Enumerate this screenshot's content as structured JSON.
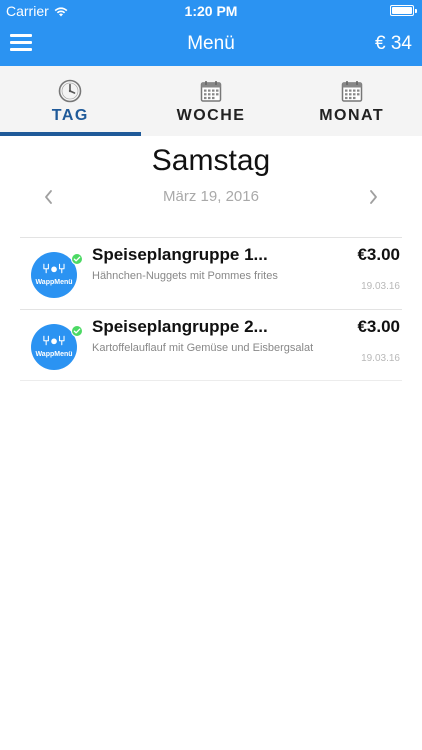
{
  "status_bar": {
    "carrier": "Carrier",
    "time": "1:20 PM",
    "wifi_icon": "wifi-icon",
    "battery_icon": "battery-icon"
  },
  "nav": {
    "title": "Menü",
    "balance": "€ 34",
    "menu_icon": "hamburger-menu-icon"
  },
  "tabs": [
    {
      "label": "TAG",
      "icon": "clock-icon",
      "active": true
    },
    {
      "label": "WOCHE",
      "icon": "calendar-icon",
      "active": false
    },
    {
      "label": "MONAT",
      "icon": "calendar-icon",
      "active": false
    }
  ],
  "day": {
    "title": "Samstag",
    "date": "März 19, 2016",
    "prev_icon": "chevron-left-icon",
    "next_icon": "chevron-right-icon"
  },
  "meals": [
    {
      "title": "Speiseplangruppe 1...",
      "description": "Hähnchen-Nuggets mit Pommes frites",
      "price": "€3.00",
      "date": "19.03.16",
      "logo_text": "WappMenü",
      "status_icon": "check-icon"
    },
    {
      "title": "Speiseplangruppe 2...",
      "description": "Kartoffelauflauf mit Gemüse und Eisbergsalat",
      "price": "€3.00",
      "date": "19.03.16",
      "logo_text": "WappMenü",
      "status_icon": "check-icon"
    }
  ],
  "colors": {
    "primary": "#2b93f2",
    "active_tab": "#1f5a99",
    "check": "#4cd964"
  }
}
